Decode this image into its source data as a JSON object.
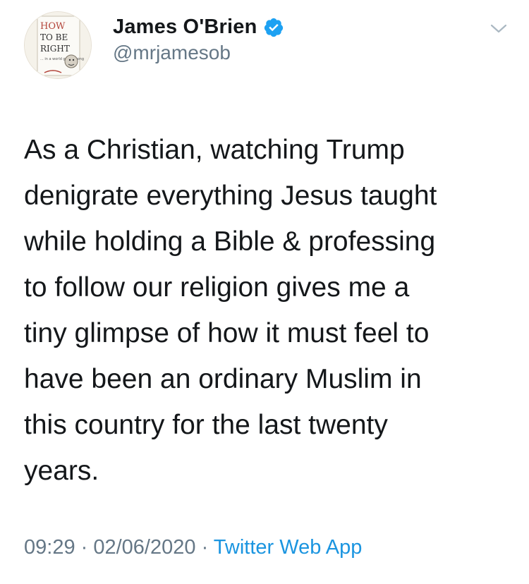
{
  "author": {
    "display_name": "James O'Brien",
    "handle": "@mrjamesob",
    "verified": true,
    "avatar_text": [
      "HOW",
      "TO BE",
      "RIGHT",
      "... in a world gone wrong"
    ]
  },
  "tweet": {
    "text": "As a Christian, watching Trump\ndenigrate everything Jesus taught\nwhile holding a Bible & professing\nto follow our religion gives me a\ntiny glimpse of how it must feel to\nhave been an ordinary Muslim in\nthis country for the last twenty\nyears.",
    "time": "09:29",
    "separator1": " · ",
    "date": "02/06/2020",
    "separator2": " · ",
    "source": "Twitter Web App"
  },
  "icons": {
    "verified": "verified-badge-icon",
    "menu": "chevron-down-icon"
  },
  "colors": {
    "text": "#14171a",
    "secondary": "#657786",
    "link": "#1b95e0",
    "verified": "#1da1f2"
  }
}
